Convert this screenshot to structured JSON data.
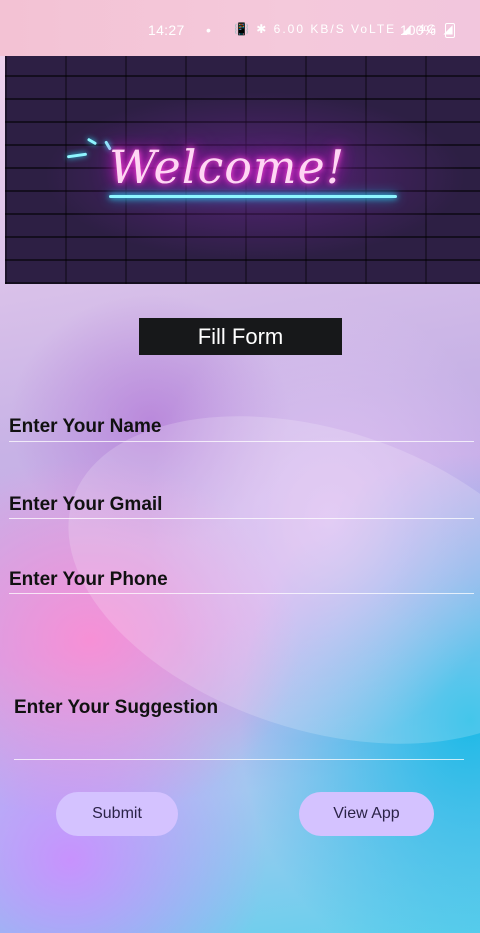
{
  "status_bar": {
    "time": "14:27",
    "dot": "•",
    "icons": "📳 ✱ 6.00 KB/S VoLTE ◢ 4G ◢",
    "battery": "100%"
  },
  "banner": {
    "text": "Welcome!"
  },
  "form": {
    "title": "Fill Form",
    "fields": [
      {
        "label": "Enter Your Name"
      },
      {
        "label": "Enter Your Gmail"
      },
      {
        "label": "Enter Your Phone"
      },
      {
        "label": "Enter Your Suggestion"
      }
    ],
    "buttons": {
      "submit": "Submit",
      "view_app": "View App"
    }
  },
  "colors": {
    "button_bg": "#d4c2ff",
    "title_bg": "#17181a",
    "neon_pink": "#ff4fd8",
    "neon_cyan": "#8ef6ff"
  }
}
